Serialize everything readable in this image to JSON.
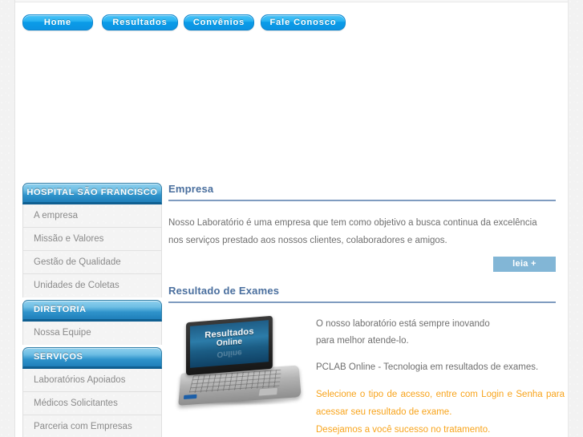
{
  "topnav": {
    "items": [
      {
        "label": "Home"
      },
      {
        "label": "Resultados"
      },
      {
        "label": "Convênios"
      },
      {
        "label": "Fale Conosco"
      }
    ]
  },
  "sidebar": {
    "groups": [
      {
        "header": "HOSPITAL SÃO FRANCISCO",
        "align": "center",
        "items": [
          {
            "label": "A empresa"
          },
          {
            "label": "Missão e Valores"
          },
          {
            "label": "Gestão de Qualidade"
          },
          {
            "label": "Unidades de Coletas"
          }
        ]
      },
      {
        "header": "DIRETORIA",
        "align": "left",
        "items": [
          {
            "label": "Nossa Equipe"
          }
        ]
      },
      {
        "header": "SERVIÇOS",
        "align": "left",
        "items": [
          {
            "label": "Laboratórios Apoiados"
          },
          {
            "label": "Médicos Solicitantes"
          },
          {
            "label": "Parceria com Empresas"
          }
        ]
      }
    ]
  },
  "main": {
    "empresa": {
      "title": "Empresa",
      "paragraph": "Nosso Laboratório é uma empresa que tem como objetivo a busca continua da excelência nos serviços prestado aos nossos clientes, colaboradores e amigos.",
      "leia_label": "leia +"
    },
    "resultado": {
      "title": "Resultado de Exames",
      "laptop_line1": "Resultados",
      "laptop_line2": "Online",
      "line1": "O nosso laboratório está sempre inovando",
      "line2": "para melhor atende-lo.",
      "line3": "PCLAB Online - Tecnologia em resultados de exames.",
      "orange1": "Selecione o tipo de acesso, entre com Login e Senha para acessar seu resultado de exame.",
      "orange2": "Desejamos a você sucesso no tratamento."
    }
  },
  "colors": {
    "nav_button": "#0b9ce8",
    "sidebar_header": "#2f93cb",
    "section_title": "#4a6f9e",
    "leia_button": "#82b6d6",
    "orange_text": "#f8a41c",
    "body_text": "#6f6f6f"
  }
}
